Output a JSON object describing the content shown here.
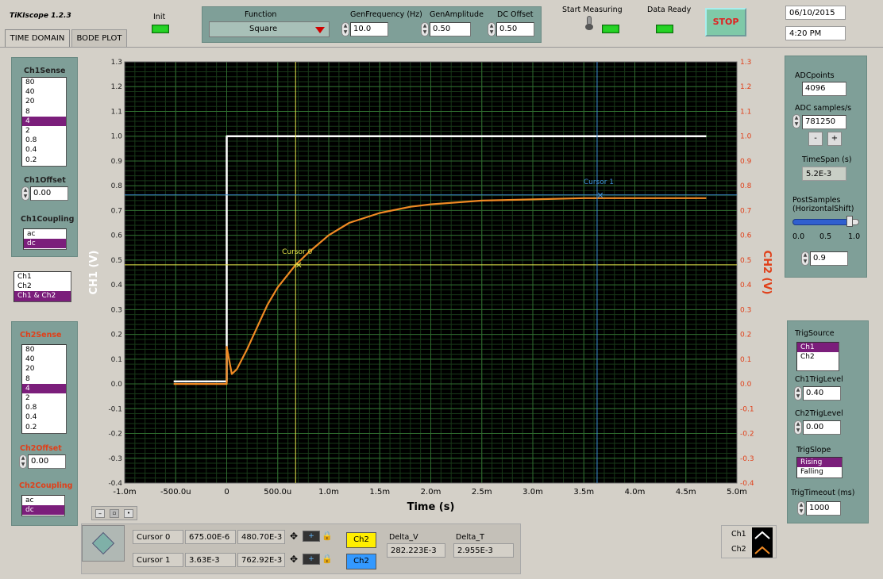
{
  "app": {
    "title": "TiKIscope 1.2.3"
  },
  "tabs": [
    {
      "label": "TIME DOMAIN",
      "active": true
    },
    {
      "label": "BODE PLOT",
      "active": false
    }
  ],
  "top": {
    "init_label": "Init",
    "function_label": "Function",
    "function_value": "Square",
    "gen_freq_label": "GenFrequency (Hz)",
    "gen_freq_value": "10.0",
    "gen_amp_label": "GenAmplitude",
    "gen_amp_value": "0.50",
    "dc_offset_label": "DC Offset",
    "dc_offset_value": "0.50",
    "start_label": "Start Measuring",
    "ready_label": "Data Ready",
    "stop_label": "STOP",
    "date": "06/10/2015",
    "time": "4:20 PM"
  },
  "ch1": {
    "sense_label": "Ch1Sense",
    "sense_options": [
      "80",
      "40",
      "20",
      "8",
      "4",
      "2",
      "0.8",
      "0.4",
      "0.2"
    ],
    "sense_selected": 4,
    "offset_label": "Ch1Offset",
    "offset_value": "0.00",
    "coupling_label": "Ch1Coupling",
    "coupling_options": [
      "ac",
      "dc"
    ],
    "coupling_selected": 1
  },
  "channel_select": {
    "options": [
      "Ch1",
      "Ch2",
      "Ch1 & Ch2"
    ],
    "selected": 2
  },
  "ch2": {
    "sense_label": "Ch2Sense",
    "sense_options": [
      "80",
      "40",
      "20",
      "8",
      "4",
      "2",
      "0.8",
      "0.4",
      "0.2"
    ],
    "sense_selected": 4,
    "offset_label": "Ch2Offset",
    "offset_value": "0.00",
    "coupling_label": "Ch2Coupling",
    "coupling_options": [
      "ac",
      "dc"
    ],
    "coupling_selected": 1
  },
  "right": {
    "adc_points_label": "ADCpoints",
    "adc_points_value": "4096",
    "adc_sps_label": "ADC samples/s",
    "adc_sps_value": "781250",
    "minus": "-",
    "plus": "+",
    "timespan_label": "TimeSpan (s)",
    "timespan_value": "5.2E-3",
    "post_label_1": "PostSamples",
    "post_label_2": "(HorizontalShift)",
    "slider_ticks": [
      "0.0",
      "0.5",
      "1.0"
    ],
    "slider_fraction": 0.9,
    "post_value": "0.9"
  },
  "trigger": {
    "source_label": "TrigSource",
    "source_options": [
      "Ch1",
      "Ch2"
    ],
    "source_selected": 0,
    "ch1_level_label": "Ch1TrigLevel",
    "ch1_level_value": "0.40",
    "ch2_level_label": "Ch2TrigLevel",
    "ch2_level_value": "0.00",
    "slope_label": "TrigSlope",
    "slope_options": [
      "Rising",
      "Falling"
    ],
    "slope_selected": 0,
    "timeout_label": "TrigTimeout (ms)",
    "timeout_value": "1000"
  },
  "cursors": {
    "rows": [
      {
        "name": "Cursor 0",
        "x": "675.00E-6",
        "y": "480.70E-3",
        "channel": "Ch2",
        "channel_color": "#ffee00"
      },
      {
        "name": "Cursor 1",
        "x": "3.63E-3",
        "y": "762.92E-3",
        "channel": "Ch2",
        "channel_color": "#3399ff"
      }
    ],
    "delta_v_label": "Delta_V",
    "delta_v_value": "282.223E-3",
    "delta_t_label": "Delta_T",
    "delta_t_value": "2.955E-3"
  },
  "legend": {
    "ch1": "Ch1",
    "ch2": "Ch2"
  },
  "colors": {
    "ch1": "#ffffff",
    "ch2": "#f08a24",
    "plot_bg": "#000000",
    "grid": "#2f6b2f",
    "cursor0": "#e6e64a",
    "cursor1": "#3e8fd6",
    "axis_right": "#e0401a"
  },
  "chart_data": {
    "type": "line",
    "xlabel": "Time (s)",
    "ylabel_left": "CH1 (V)",
    "ylabel_right": "CH2 (V)",
    "xlim": [
      -0.001,
      0.005
    ],
    "ylim": [
      -0.4,
      1.3
    ],
    "x_ticks": [
      "-1.0m",
      "-500.0u",
      "0",
      "500.0u",
      "1.0m",
      "1.5m",
      "2.0m",
      "2.5m",
      "3.0m",
      "3.5m",
      "4.0m",
      "4.5m",
      "5.0m"
    ],
    "y_ticks": [
      "-0.4",
      "-0.3",
      "-0.2",
      "-0.1",
      "0.0",
      "0.1",
      "0.2",
      "0.3",
      "0.4",
      "0.5",
      "0.6",
      "0.7",
      "0.8",
      "0.9",
      "1.0",
      "1.1",
      "1.2",
      "1.3"
    ],
    "series": [
      {
        "name": "Ch1",
        "x": [
          -0.00052,
          0.0,
          0.0,
          0.0047
        ],
        "y": [
          0.01,
          0.01,
          1.0,
          1.0
        ]
      },
      {
        "name": "Ch2",
        "x": [
          -0.00052,
          0.0,
          0.0,
          5e-05,
          0.0001,
          0.0002,
          0.0003,
          0.0004,
          0.0005,
          0.000675,
          0.0008,
          0.001,
          0.0012,
          0.0015,
          0.0018,
          0.002,
          0.0025,
          0.003,
          0.0035,
          0.004,
          0.0047
        ],
        "y": [
          0.0,
          0.0,
          0.15,
          0.04,
          0.06,
          0.14,
          0.23,
          0.32,
          0.39,
          0.48,
          0.53,
          0.6,
          0.65,
          0.69,
          0.715,
          0.725,
          0.74,
          0.745,
          0.75,
          0.75,
          0.75
        ]
      }
    ],
    "cursors": [
      {
        "label": "Cursor 0",
        "x": 0.000675,
        "y": 0.4807
      },
      {
        "label": "Cursor 1",
        "x": 0.00363,
        "y": 0.7629
      }
    ]
  }
}
